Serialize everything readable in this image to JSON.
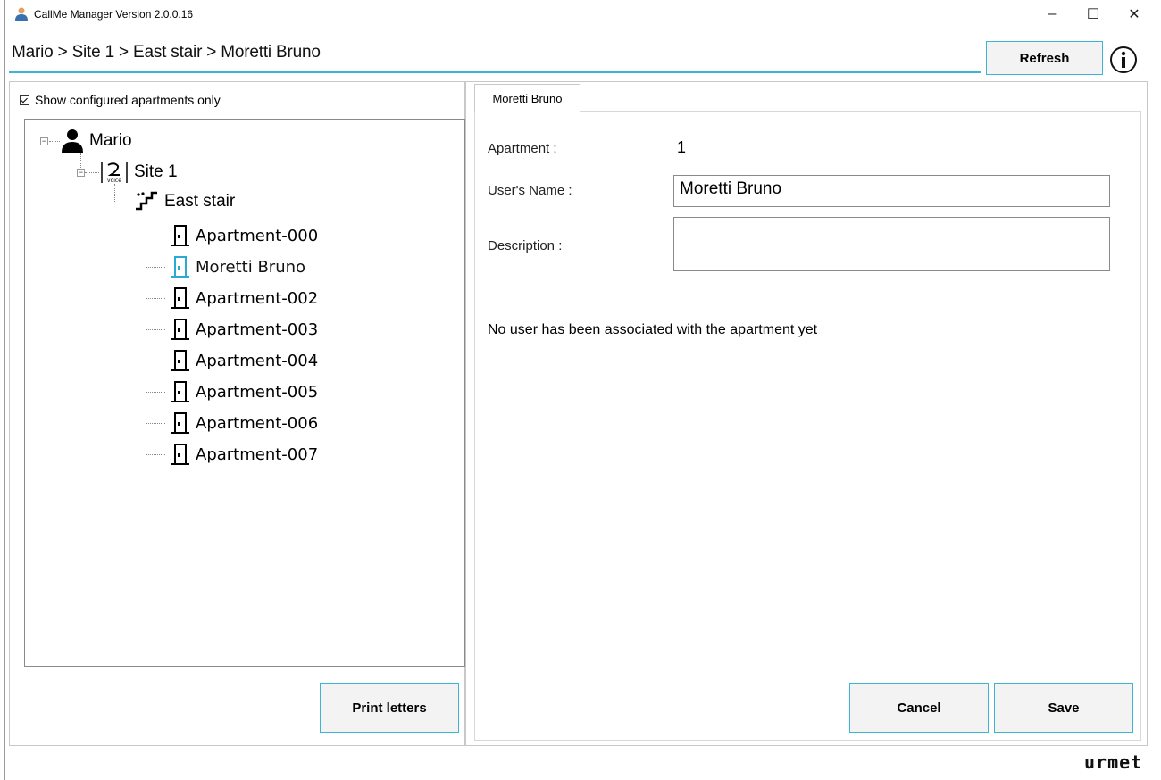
{
  "window": {
    "title": "CallMe Manager Version 2.0.0.16",
    "controls": {
      "minimize": "–",
      "maximize": "☐",
      "close": "✕"
    }
  },
  "header": {
    "breadcrumb": "Mario > Site 1 > East stair > Moretti Bruno",
    "refresh_label": "Refresh",
    "info_icon": "info-icon"
  },
  "left": {
    "show_configured_label": "Show configured apartments only",
    "show_configured_checked": true,
    "tree": {
      "root": "Mario",
      "site": "Site 1",
      "stair": "East stair",
      "apartments": [
        "Apartment-000",
        "Moretti Bruno",
        "Apartment-002",
        "Apartment-003",
        "Apartment-004",
        "Apartment-005",
        "Apartment-006",
        "Apartment-007"
      ],
      "selected": "Moretti Bruno"
    },
    "print_label": "Print letters"
  },
  "right": {
    "tab_label": "Moretti Bruno",
    "apartment_label": "Apartment :",
    "apartment_value": "1",
    "username_label": "User's Name :",
    "username_value": "Moretti Bruno",
    "description_label": "Description :",
    "description_value": "",
    "association_note": "No user has been associated with the apartment yet",
    "cancel_label": "Cancel",
    "save_label": "Save"
  },
  "brand": "urmet",
  "colors": {
    "accent": "#3cb5d4",
    "selected_icon": "#2aa9d6"
  }
}
